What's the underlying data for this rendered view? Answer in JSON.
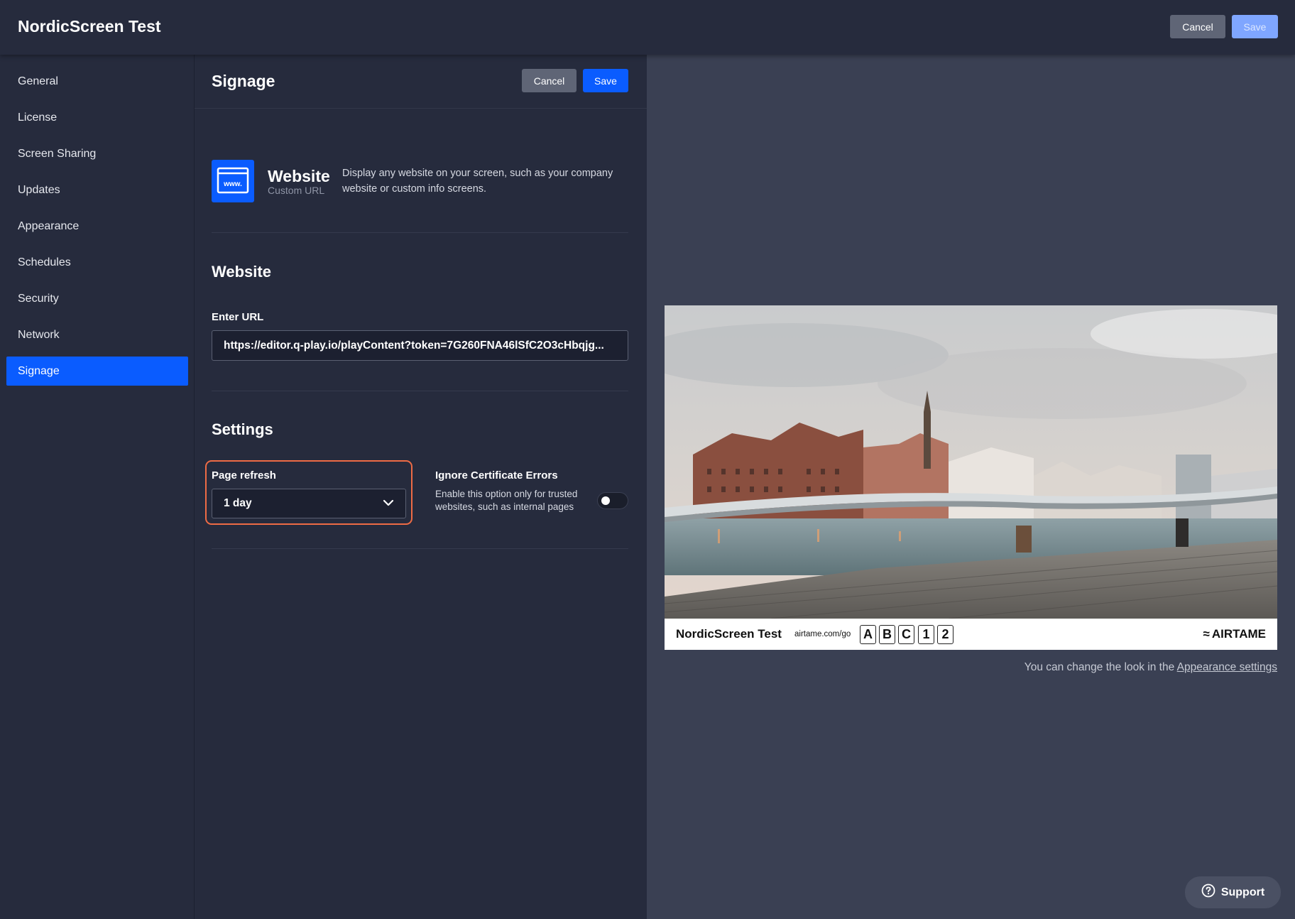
{
  "app": {
    "title": "NordicScreen Test",
    "cancel_label": "Cancel",
    "save_label": "Save"
  },
  "sidebar": {
    "items": [
      {
        "label": "General",
        "active": false
      },
      {
        "label": "License",
        "active": false
      },
      {
        "label": "Screen Sharing",
        "active": false
      },
      {
        "label": "Updates",
        "active": false
      },
      {
        "label": "Appearance",
        "active": false
      },
      {
        "label": "Schedules",
        "active": false
      },
      {
        "label": "Security",
        "active": false
      },
      {
        "label": "Network",
        "active": false
      },
      {
        "label": "Signage",
        "active": true
      }
    ]
  },
  "signage": {
    "title": "Signage",
    "cancel_label": "Cancel",
    "save_label": "Save",
    "source": {
      "icon": "www-browser-icon",
      "icon_text": "www.",
      "name": "Website",
      "type": "Custom URL",
      "description": "Display any website on your screen, such as your company website or custom info screens."
    },
    "website_section": {
      "title": "Website",
      "url_label": "Enter URL",
      "url_value": "https://editor.q-play.io/playContent?token=7G260FNA46lSfC2O3cHbqjg..."
    },
    "settings_section": {
      "title": "Settings",
      "page_refresh_label": "Page refresh",
      "page_refresh_value": "1 day",
      "cert_label": "Ignore Certificate Errors",
      "cert_description": "Enable this option only for trusted websites, such as internal pages",
      "cert_enabled": false
    }
  },
  "preview": {
    "device_name": "NordicScreen Test",
    "join_url": "airtame.com/go",
    "code": [
      "A",
      "B",
      "C",
      "1",
      "2"
    ],
    "brand": "AIRTAME",
    "note_prefix": "You can change the look in the ",
    "note_link": "Appearance settings"
  },
  "support": {
    "label": "Support"
  },
  "colors": {
    "accent": "#0a5cff",
    "highlight": "#ee6b45",
    "panel": "#262b3d",
    "background": "#3a4053"
  }
}
